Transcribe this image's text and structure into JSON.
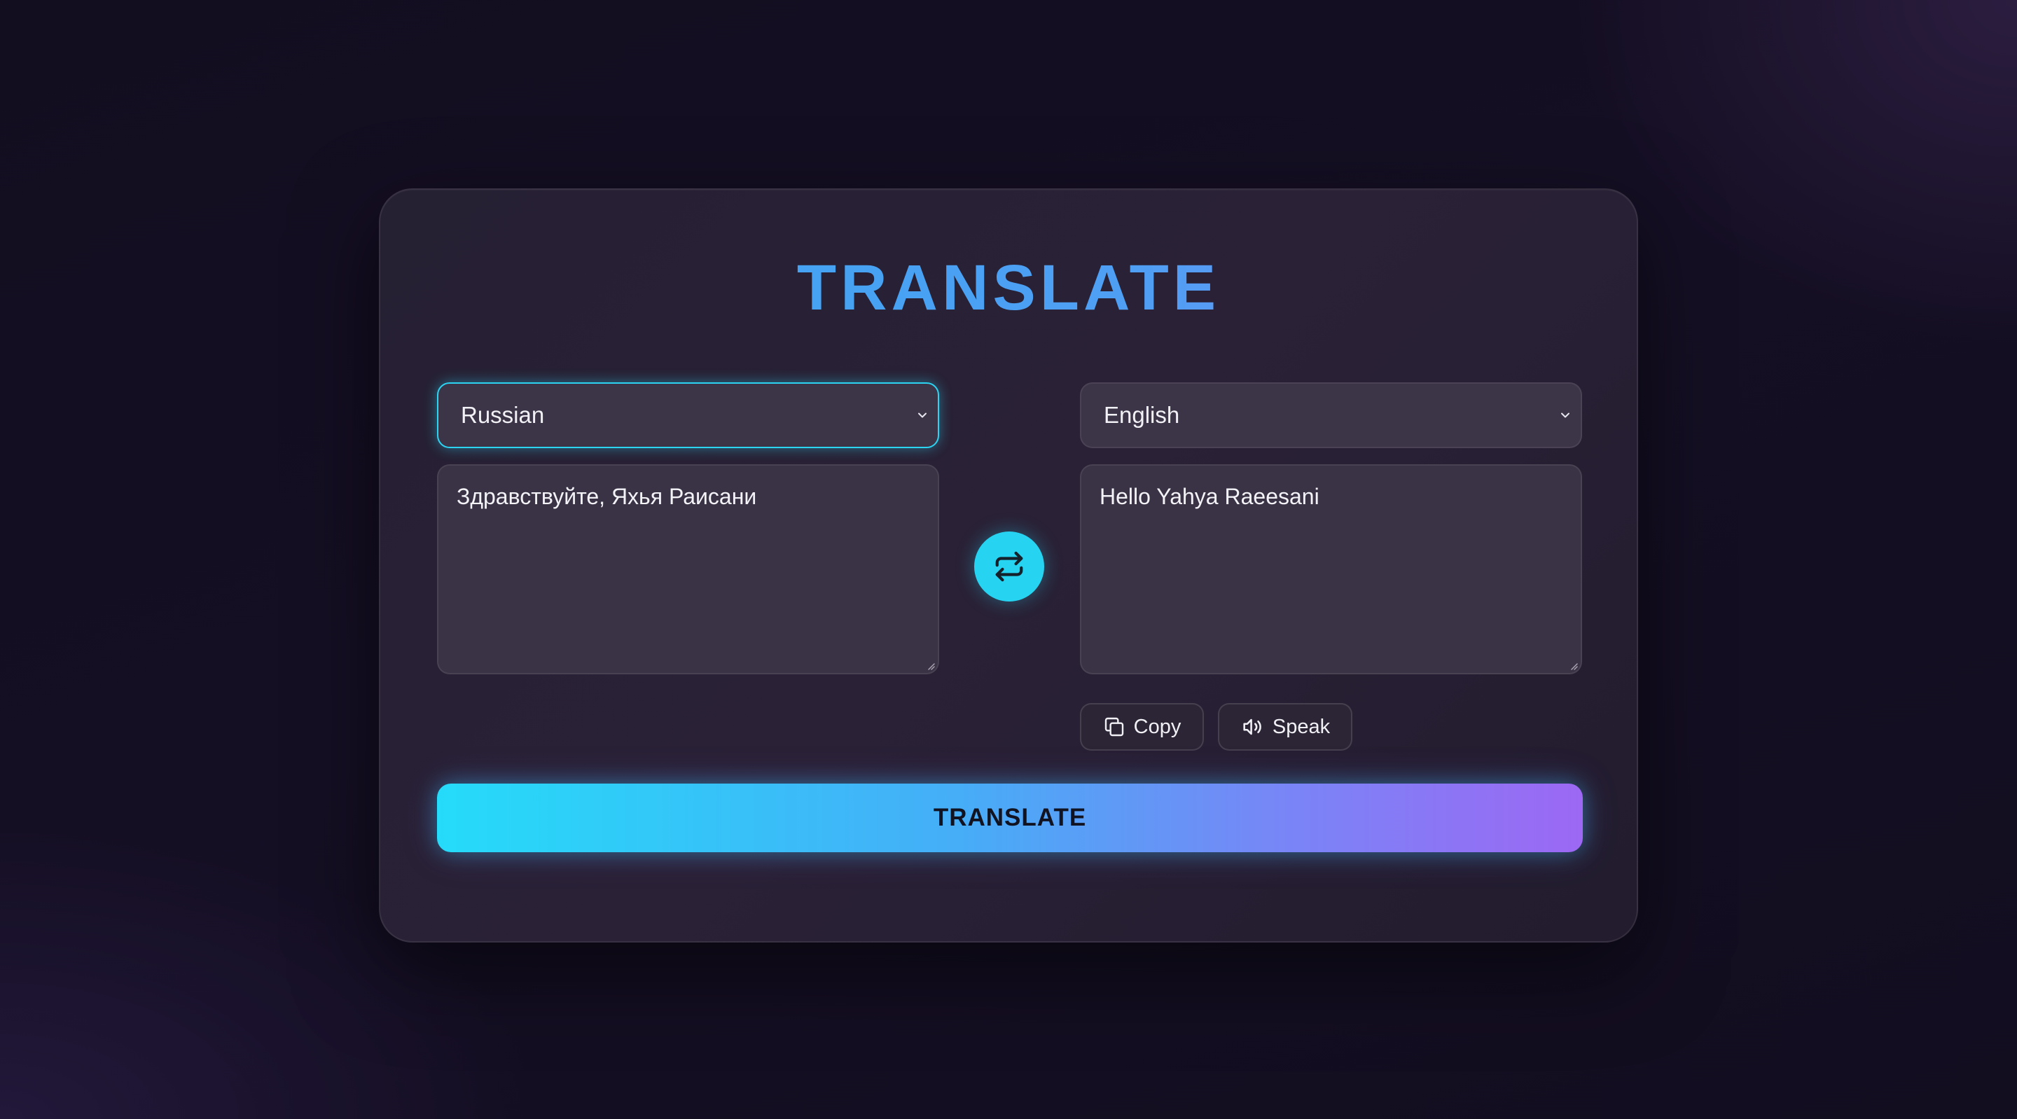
{
  "app": {
    "title": "TRANSLATE"
  },
  "source": {
    "language": "Russian",
    "text": "Здравствуйте, Яхья Раисани"
  },
  "target": {
    "language": "English",
    "text": "Hello Yahya Raeesani"
  },
  "actions": {
    "copy_label": "Copy",
    "speak_label": "Speak",
    "translate_label": "TRANSLATE"
  },
  "icons": {
    "swap": "swap-arrows-icon",
    "copy": "copy-icon",
    "speak": "speaker-icon",
    "dropdown": "chevron-down-icon"
  },
  "colors": {
    "accent_cyan": "#26d3f1",
    "accent_purple": "#9c68f4",
    "title_blue": "#3aa7f0"
  }
}
